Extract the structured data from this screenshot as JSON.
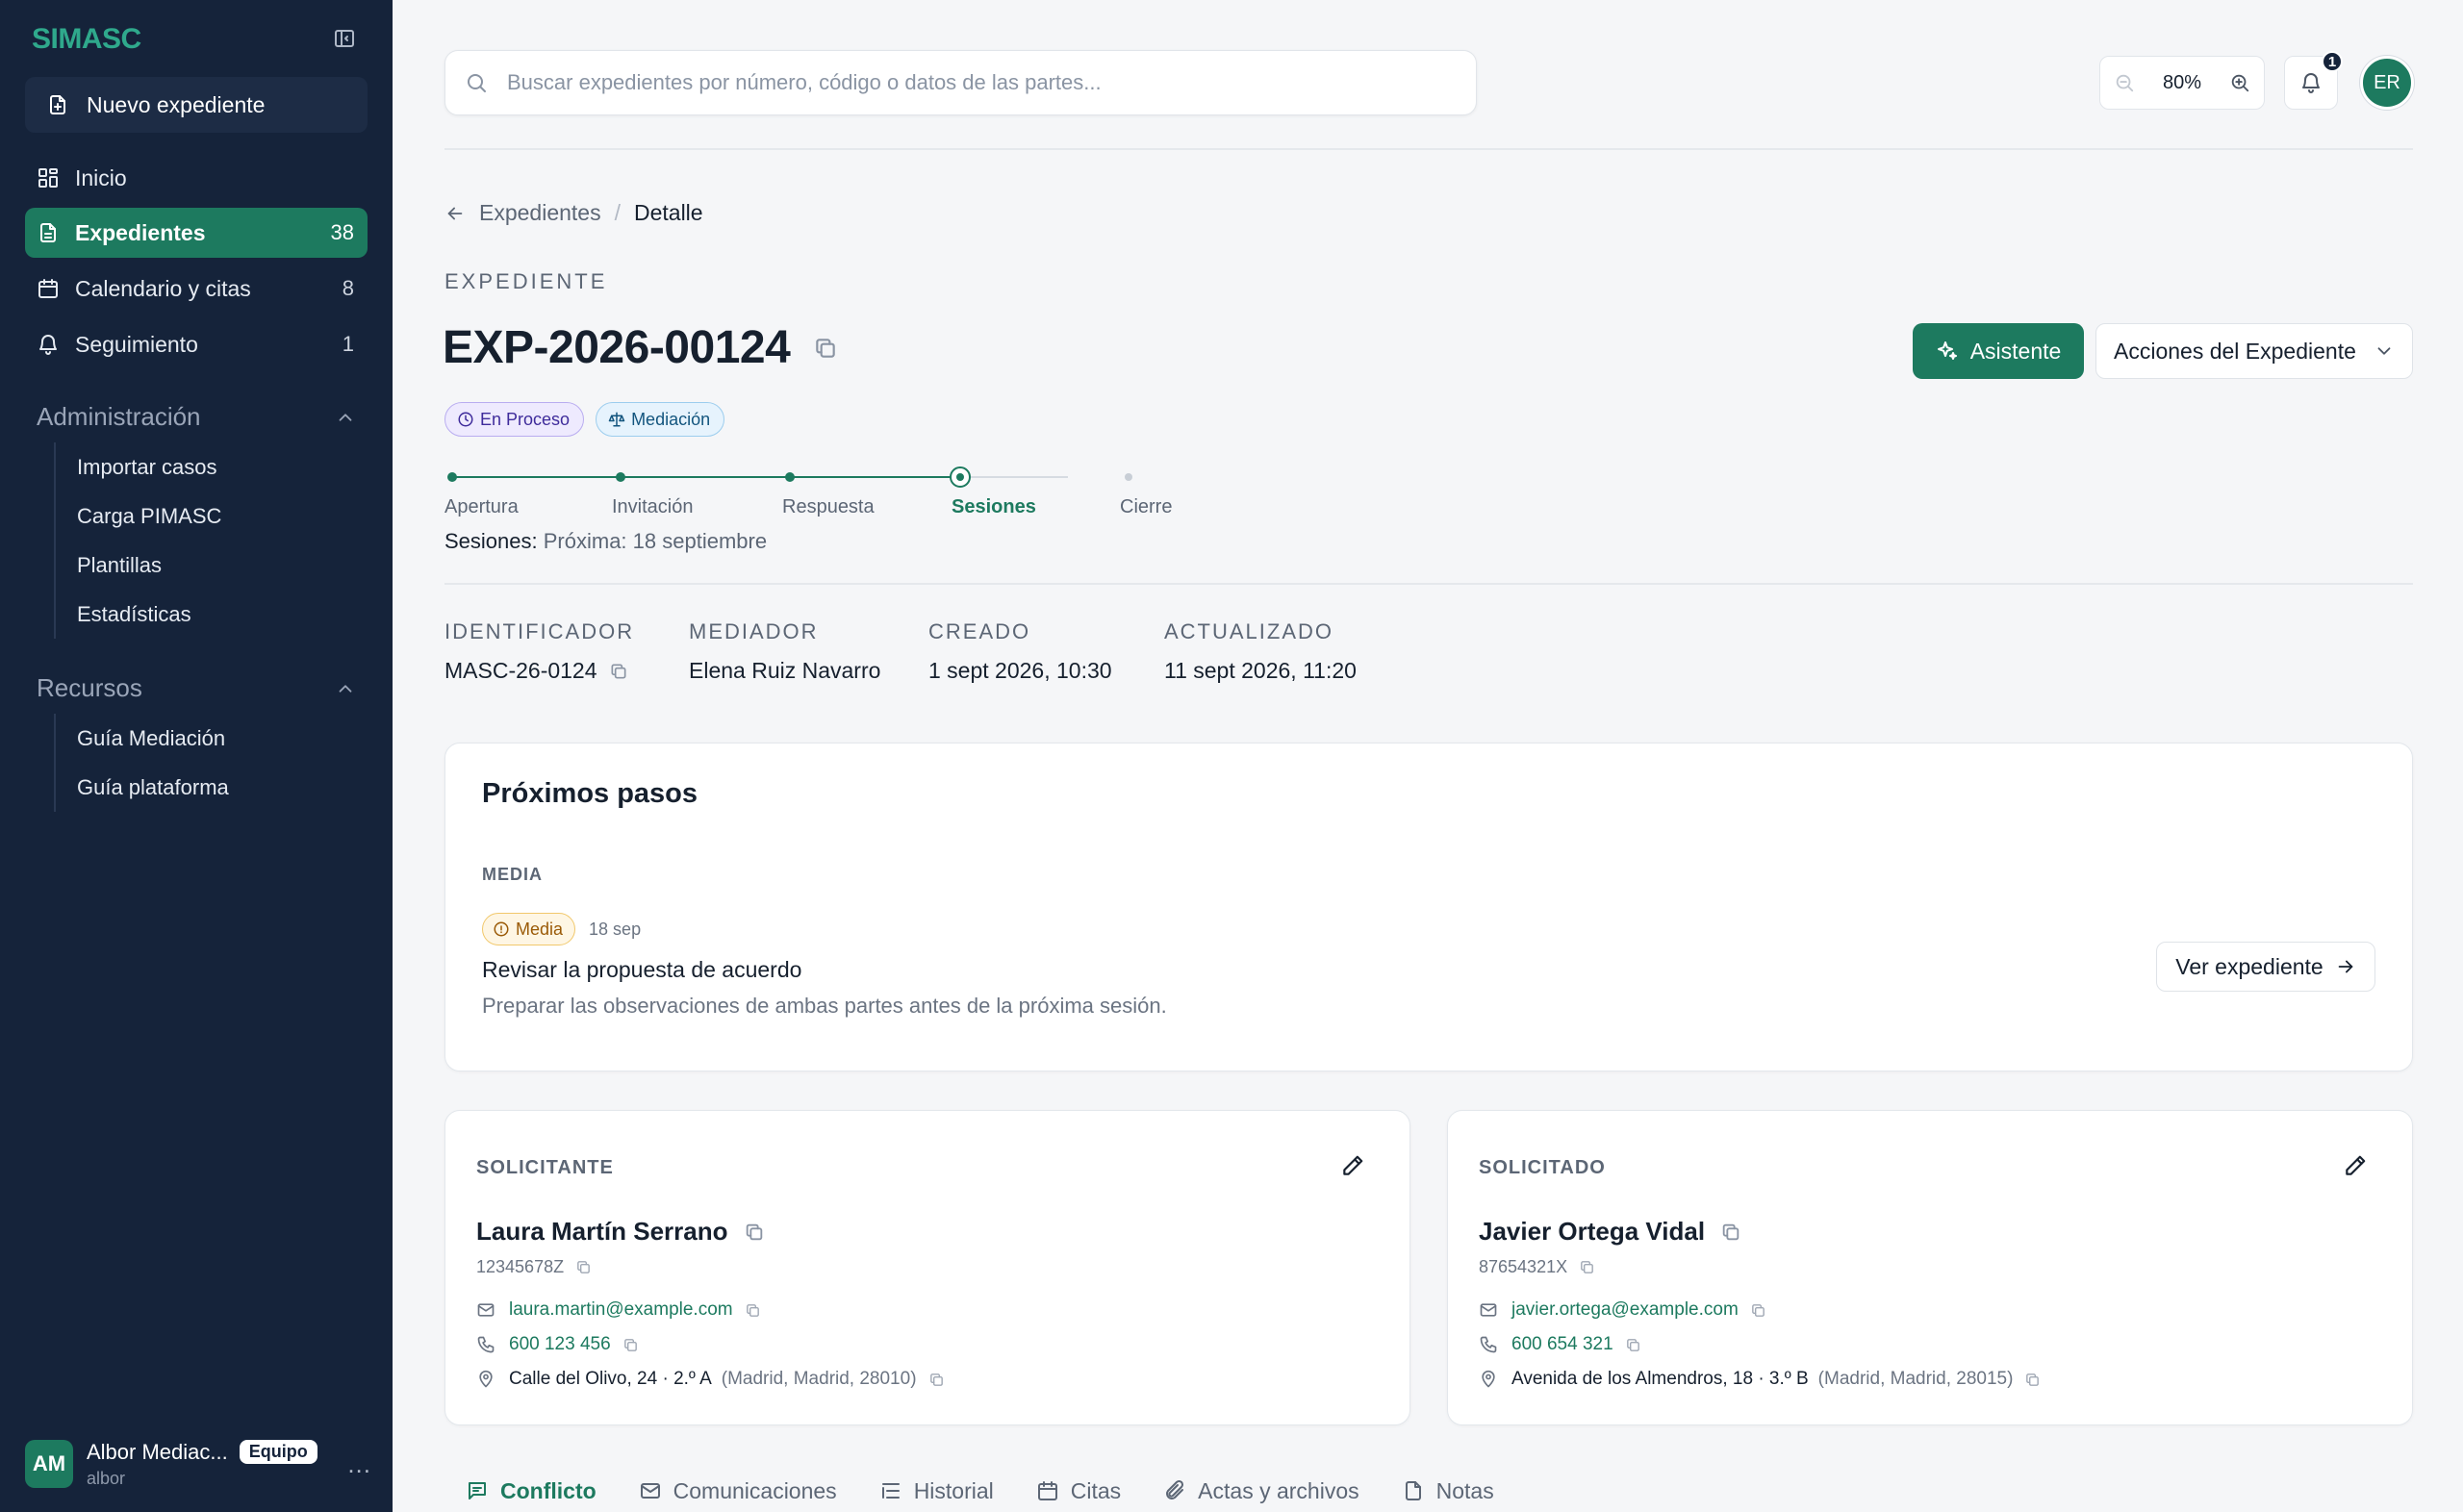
{
  "app": {
    "brand": "SIMASC"
  },
  "sidebar": {
    "new_case": "Nuevo expediente",
    "nav": [
      {
        "label": "Inicio",
        "count": "",
        "icon": "dashboard-icon"
      },
      {
        "label": "Expedientes",
        "count": "38",
        "icon": "document-icon",
        "active": true
      },
      {
        "label": "Calendario y citas",
        "count": "8",
        "icon": "calendar-icon"
      },
      {
        "label": "Seguimiento",
        "count": "1",
        "icon": "bell-icon"
      }
    ],
    "admin": {
      "title": "Administración",
      "items": [
        "Importar casos",
        "Carga PIMASC",
        "Plantillas",
        "Estadísticas"
      ]
    },
    "resources": {
      "title": "Recursos",
      "items": [
        "Guía Mediación",
        "Guía plataforma"
      ]
    },
    "user": {
      "initials": "AM",
      "name": "Albor Mediac...",
      "badge": "Equipo",
      "sub": "albor",
      "more": "..."
    }
  },
  "topbar": {
    "search_placeholder": "Buscar expedientes por número, código o datos de las partes...",
    "zoom": "80%",
    "notifications": "1",
    "avatar": "ER"
  },
  "breadcrumb": {
    "parent": "Expedientes",
    "sep": "/",
    "current": "Detalle"
  },
  "case": {
    "kicker": "EXPEDIENTE",
    "number": "EXP-2026-00124",
    "badges": [
      "En Proceso",
      "Mediación"
    ],
    "actions": {
      "assistant": "Asistente",
      "menu": "Acciones del Expediente"
    },
    "steps": [
      {
        "label": "Apertura",
        "state": "done"
      },
      {
        "label": "Invitación",
        "state": "done"
      },
      {
        "label": "Respuesta",
        "state": "done"
      },
      {
        "label": "Sesiones",
        "state": "current"
      },
      {
        "label": "Cierre",
        "state": "pending"
      }
    ],
    "step_note_key": "Sesiones:",
    "step_note_val": "Próxima: 18 septiembre",
    "meta": [
      {
        "key": "IDENTIFICADOR",
        "value": "MASC-26-0124",
        "copy": true
      },
      {
        "key": "MEDIADOR",
        "value": "Elena Ruiz Navarro"
      },
      {
        "key": "CREADO",
        "value": "1 sept 2026, 10:30"
      },
      {
        "key": "ACTUALIZADO",
        "value": "11 sept 2026, 11:20"
      }
    ]
  },
  "next_steps": {
    "title": "Próximos pasos",
    "priority_group": "MEDIA",
    "priority_badge": "Media",
    "date": "18 sep",
    "task_title": "Revisar la propuesta de acuerdo",
    "task_desc": "Preparar las observaciones de ambas partes antes de la próxima sesión.",
    "button": "Ver expediente"
  },
  "parties": {
    "applicant": {
      "role": "SOLICITANTE",
      "name": "Laura Martín Serrano",
      "id": "12345678Z",
      "email": "laura.martin@example.com",
      "phone": "600 123 456",
      "address": "Calle del Olivo, 24 · 2.º A",
      "location": "(Madrid, Madrid, 28010)"
    },
    "respondent": {
      "role": "SOLICITADO",
      "name": "Javier Ortega Vidal",
      "id": "87654321X",
      "email": "javier.ortega@example.com",
      "phone": "600 654 321",
      "address": "Avenida de los Almendros, 18 · 3.º B",
      "location": "(Madrid, Madrid, 28015)"
    }
  },
  "tabs": [
    "Conflicto",
    "Comunicaciones",
    "Historial",
    "Citas",
    "Actas y archivos",
    "Notas"
  ],
  "colors": {
    "accent": "#1d7a5f",
    "sidebar": "#15233a",
    "brand": "#2fa98c"
  }
}
